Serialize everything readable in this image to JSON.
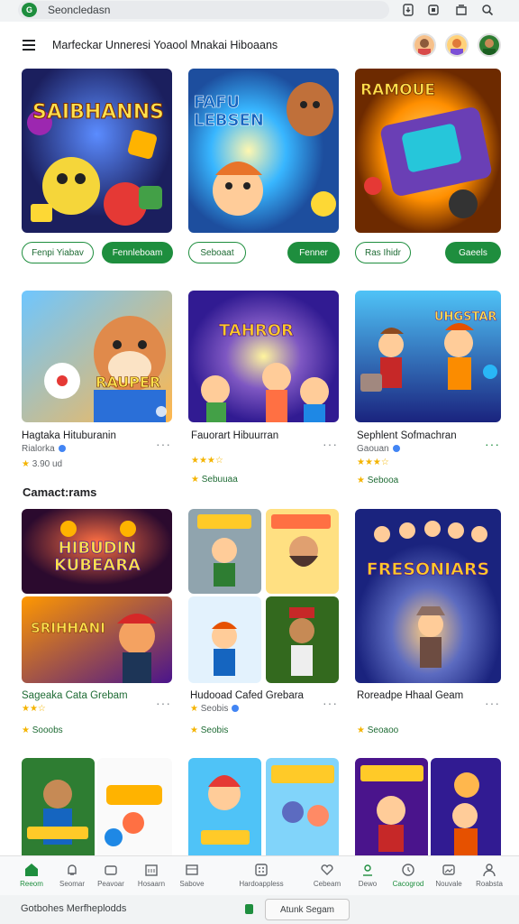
{
  "browser": {
    "site_badge": "G",
    "url": "Seoncledasn"
  },
  "header": {
    "title": "Marfeckar Unneresi  Yoaool  Mnakai  Hiboaans"
  },
  "top_cards": [
    {
      "title_art": "SAIBHANNS",
      "btn_left": "Fenpi Yiabav",
      "btn_right": "Fennleboam"
    },
    {
      "title_art": "FAFU LEBSEN",
      "btn_left": "Seboaat",
      "btn_right": "Fenner"
    },
    {
      "title_art": "RAMOUE",
      "btn_left": "Ras Ihidr",
      "btn_right": "Gaeels"
    }
  ],
  "mid_cards": [
    {
      "title_art": "RAUPER",
      "title": "Hagtaka Hituburanin",
      "subtitle": "Rialorka",
      "rating": "3.90 ud"
    },
    {
      "title_art": "TAHROR",
      "title": "Fauorart Hibuurran",
      "subtitle": "",
      "rating": "Sebuuaa"
    },
    {
      "title_art": "UHGSTAR",
      "title": "Sephlent Sofmachran",
      "subtitle": "Gaouan",
      "rating": "Sebooa"
    }
  ],
  "section": {
    "title": "Camact:rams"
  },
  "lower_cards": [
    {
      "title_art_top": "HIBUDIN KUBEARA",
      "title_art_bottom": "SRIHHANI",
      "title": "Sageaka Cata Grebam",
      "rating": "Sooobs"
    },
    {
      "title": "Hudooad Cafed Grebara",
      "rating": "Seobis"
    },
    {
      "title_art": "FRESONIARS",
      "title": "Roreadpe Hhaal Geam",
      "rating": "Seoaoo"
    }
  ],
  "bottom_nav": [
    {
      "label": "Reeom",
      "icon": "home-icon"
    },
    {
      "label": "Seomar",
      "icon": "bell-icon"
    },
    {
      "label": "Peavoar",
      "icon": "folder-icon"
    },
    {
      "label": "Hosaarn",
      "icon": "calendar-icon"
    },
    {
      "label": "Sabove",
      "icon": "grid-icon"
    },
    {
      "label": "Hardoappless",
      "icon": "apps-icon"
    },
    {
      "label": "Cebeam",
      "icon": "heart-icon"
    },
    {
      "label": "Dewo",
      "icon": "profile-icon"
    },
    {
      "label": "Cacogrod",
      "icon": "compass-icon"
    },
    {
      "label": "Nouvale",
      "icon": "photo-icon"
    },
    {
      "label": "Roabsta",
      "icon": "person-icon"
    }
  ],
  "footer": {
    "status_text": "Gotbohes Merfheplodds",
    "button_label": "Atunk Segam"
  },
  "colors": {
    "accent": "#1e8e3e",
    "star": "#f4b400"
  }
}
